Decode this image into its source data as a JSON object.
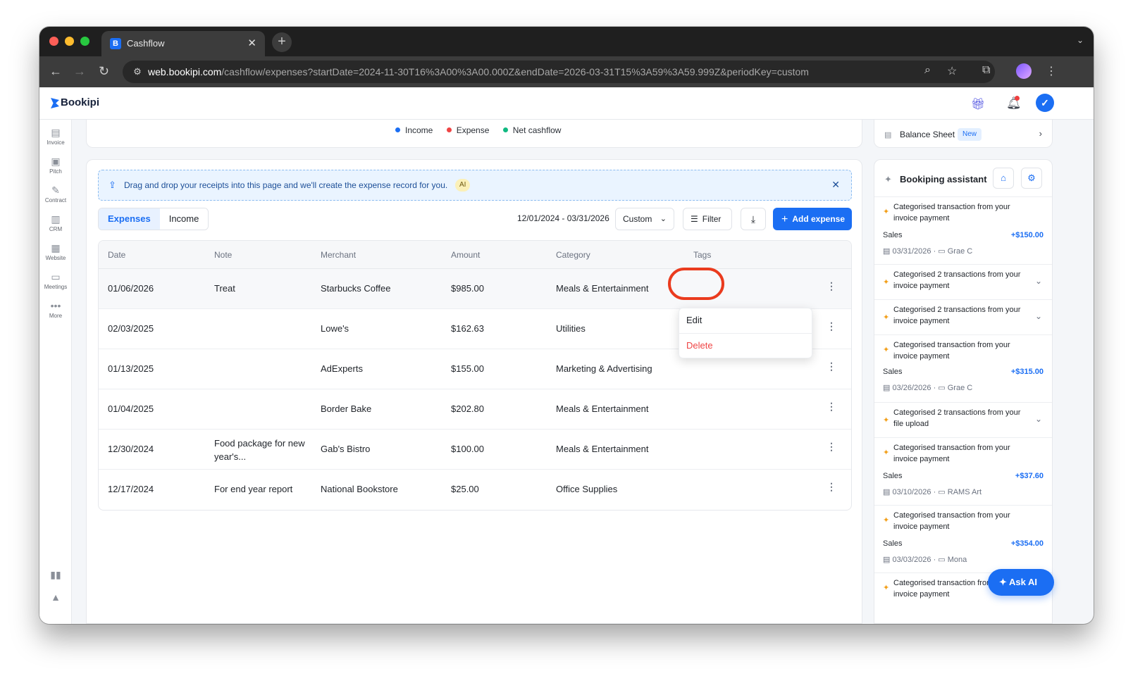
{
  "browser": {
    "tab_title": "Cashflow",
    "url_host": "web.bookipi.com",
    "url_path": "/cashflow/expenses?startDate=2024-11-30T16%3A00%3A00.000Z&endDate=2026-03-31T15%3A59%3A59.999Z&periodKey=custom"
  },
  "app": {
    "logo": "Bookipi"
  },
  "leftnav": [
    {
      "label": "Invoice",
      "icon": "invoice-icon"
    },
    {
      "label": "Pitch",
      "icon": "pitch-icon"
    },
    {
      "label": "Contract",
      "icon": "contract-icon"
    },
    {
      "label": "CRM",
      "icon": "crm-icon"
    },
    {
      "label": "Website",
      "icon": "website-icon"
    },
    {
      "label": "Meetings",
      "icon": "meetings-icon"
    },
    {
      "label": "More",
      "icon": "more-icon"
    }
  ],
  "legend": {
    "income": "Income",
    "expense": "Expense",
    "net": "Net cashflow",
    "colors": {
      "income": "#1b6ef3",
      "expense": "#ef4444",
      "net": "#10b981"
    }
  },
  "dropzone": {
    "text": "Drag and drop your receipts into this page and we'll create the expense record for you.",
    "badge": "AI"
  },
  "tabs": {
    "expenses": "Expenses",
    "income": "Income"
  },
  "controls": {
    "date_range": "12/01/2024 - 03/31/2026",
    "period": "Custom",
    "filter": "Filter",
    "add_expense": "Add expense"
  },
  "table": {
    "headers": {
      "date": "Date",
      "note": "Note",
      "merchant": "Merchant",
      "amount": "Amount",
      "category": "Category",
      "tags": "Tags"
    },
    "rows": [
      {
        "date": "01/06/2026",
        "note": "Treat",
        "merchant": "Starbucks Coffee",
        "amount": "$985.00",
        "category": "Meals & Entertainment"
      },
      {
        "date": "02/03/2025",
        "note": "",
        "merchant": "Lowe's",
        "amount": "$162.63",
        "category": "Utilities"
      },
      {
        "date": "01/13/2025",
        "note": "",
        "merchant": "AdExperts",
        "amount": "$155.00",
        "category": "Marketing & Advertising"
      },
      {
        "date": "01/04/2025",
        "note": "",
        "merchant": "Border Bake",
        "amount": "$202.80",
        "category": "Meals & Entertainment"
      },
      {
        "date": "12/30/2024",
        "note": "Food package for new year's...",
        "merchant": "Gab's Bistro",
        "amount": "$100.00",
        "category": "Meals & Entertainment"
      },
      {
        "date": "12/17/2024",
        "note": "For end year report",
        "merchant": "National Bookstore",
        "amount": "$25.00",
        "category": "Office Supplies"
      }
    ]
  },
  "row_menu": {
    "edit": "Edit",
    "delete": "Delete"
  },
  "balance_sheet": {
    "label": "Balance Sheet",
    "badge": "New"
  },
  "assistant": {
    "title": "Bookiping assistant",
    "items": [
      {
        "title": "Categorised transaction from your invoice payment",
        "type": "Sales",
        "amount": "+$150.00",
        "date": "03/31/2026",
        "client": "Grae C"
      },
      {
        "title": "Categorised 2 transactions from your invoice payment"
      },
      {
        "title": "Categorised 2 transactions from your invoice payment"
      },
      {
        "title": "Categorised transaction from your invoice payment",
        "type": "Sales",
        "amount": "+$315.00",
        "date": "03/26/2026",
        "client": "Grae C"
      },
      {
        "title": "Categorised 2 transactions from your file upload"
      },
      {
        "title": "Categorised transaction from your invoice payment",
        "type": "Sales",
        "amount": "+$37.60",
        "date": "03/10/2026",
        "client": "RAMS Art"
      },
      {
        "title": "Categorised transaction from your invoice payment",
        "type": "Sales",
        "amount": "+$354.00",
        "date": "03/03/2026",
        "client": "Mona"
      },
      {
        "title": "Categorised transaction from your invoice payment"
      }
    ]
  },
  "ask_ai": "Ask AI"
}
